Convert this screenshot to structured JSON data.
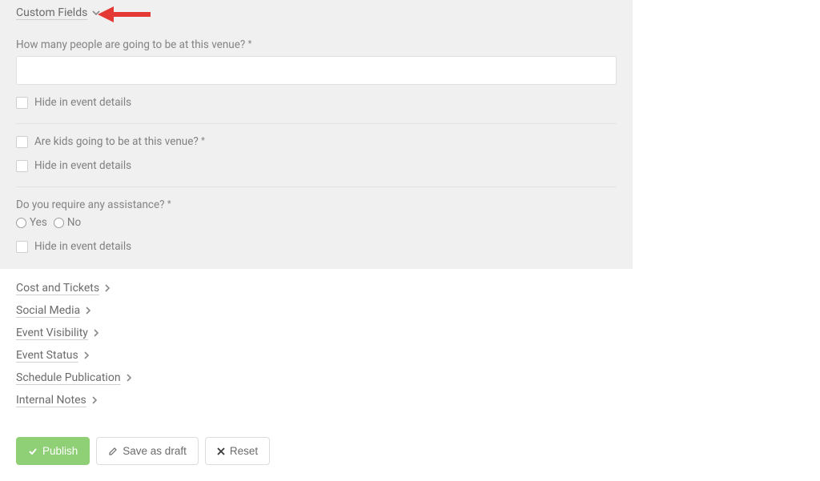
{
  "custom_fields": {
    "header": "Custom Fields",
    "q1_label": "How many people are going to be at this venue?",
    "hide_label": "Hide in event details",
    "q2_label": "Are kids going to be at this venue?",
    "q3_label": "Do you require any assistance?",
    "yes": "Yes",
    "no": "No"
  },
  "collapsed": {
    "cost": "Cost and Tickets",
    "social": "Social Media",
    "visibility": "Event Visibility",
    "status": "Event Status",
    "schedule": "Schedule Publication",
    "notes": "Internal Notes"
  },
  "buttons": {
    "publish": "Publish",
    "draft": "Save as draft",
    "reset": "Reset"
  }
}
